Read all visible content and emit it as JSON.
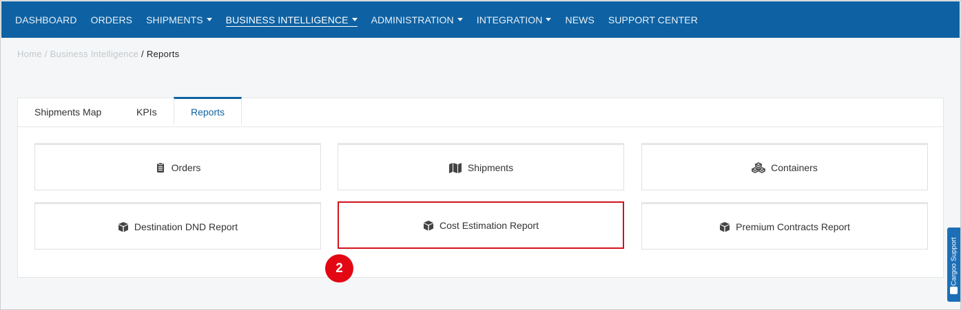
{
  "nav": {
    "items": [
      {
        "label": "DASHBOARD",
        "caret": false,
        "active": false
      },
      {
        "label": "ORDERS",
        "caret": false,
        "active": false
      },
      {
        "label": "SHIPMENTS",
        "caret": true,
        "active": false
      },
      {
        "label": "BUSINESS INTELLIGENCE",
        "caret": true,
        "active": true
      },
      {
        "label": "ADMINISTRATION",
        "caret": true,
        "active": false
      },
      {
        "label": "INTEGRATION",
        "caret": true,
        "active": false
      },
      {
        "label": "NEWS",
        "caret": false,
        "active": false
      },
      {
        "label": "SUPPORT CENTER",
        "caret": false,
        "active": false
      }
    ],
    "bg_color": "#0e62a3"
  },
  "breadcrumb": {
    "home": "Home",
    "sep1": " / ",
    "section": "Business Intelligence",
    "sep2": " / ",
    "current": "Reports"
  },
  "tabs": [
    {
      "label": "Shipments Map"
    },
    {
      "label": "KPIs"
    },
    {
      "label": "Reports",
      "active": true
    }
  ],
  "reports": [
    {
      "label": "Orders",
      "icon": "clipboard-icon"
    },
    {
      "label": "Shipments",
      "icon": "map-icon"
    },
    {
      "label": "Containers",
      "icon": "cubes-icon"
    },
    {
      "label": "Destination DND Report",
      "icon": "box-icon"
    },
    {
      "label": "Cost Estimation Report",
      "icon": "box-icon",
      "highlighted": true
    },
    {
      "label": "Premium Contracts Report",
      "icon": "box-icon"
    }
  ],
  "step_badge": "2",
  "support": {
    "label": "Cargoo Support"
  },
  "colors": {
    "accent": "#0e62a3",
    "highlight": "#d0121b",
    "badge": "#e30613"
  }
}
